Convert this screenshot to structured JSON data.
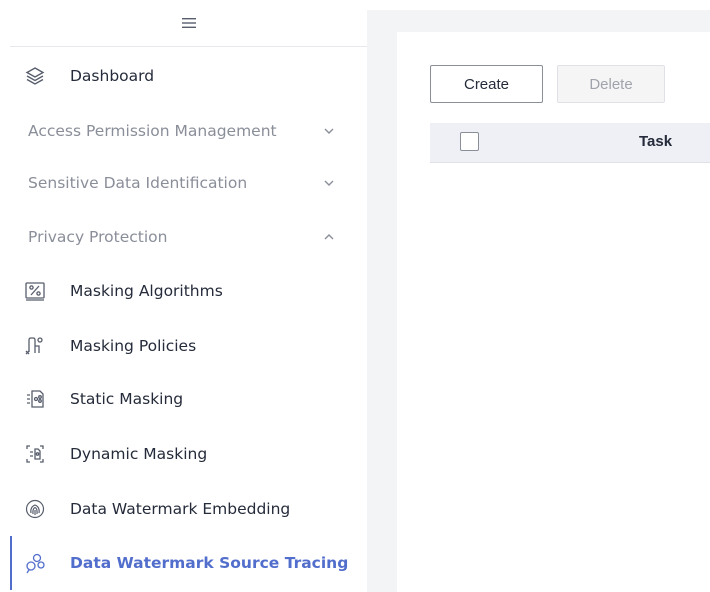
{
  "sidebar": {
    "toggle_icon": "hamburger-menu-icon",
    "items": [
      {
        "label": "Dashboard",
        "icon": "layers-icon"
      },
      {
        "label": "Access Permission Management",
        "icon": "chevron-down-icon",
        "group": true
      },
      {
        "label": "Sensitive Data Identification",
        "icon": "chevron-down-icon",
        "group": true
      },
      {
        "label": "Privacy Protection",
        "icon": "chevron-up-icon",
        "group": true
      },
      {
        "label": "Masking Algorithms",
        "icon": "percent-box-icon"
      },
      {
        "label": "Masking Policies",
        "icon": "masking-policy-icon"
      },
      {
        "label": "Static Masking",
        "icon": "static-masking-icon"
      },
      {
        "label": "Dynamic Masking",
        "icon": "dynamic-masking-icon"
      },
      {
        "label": "Data Watermark Embedding",
        "icon": "fingerprint-icon"
      },
      {
        "label": "Data Watermark Source Tracing",
        "icon": "source-tracing-icon",
        "active": true
      }
    ]
  },
  "toolbar": {
    "create_label": "Create",
    "delete_label": "Delete"
  },
  "table": {
    "columns": [
      "Task"
    ]
  },
  "colors": {
    "accent": "#526ecc",
    "text": "#252b3a",
    "muted": "#8a8e99",
    "panel_bg": "#f3f4f6"
  }
}
